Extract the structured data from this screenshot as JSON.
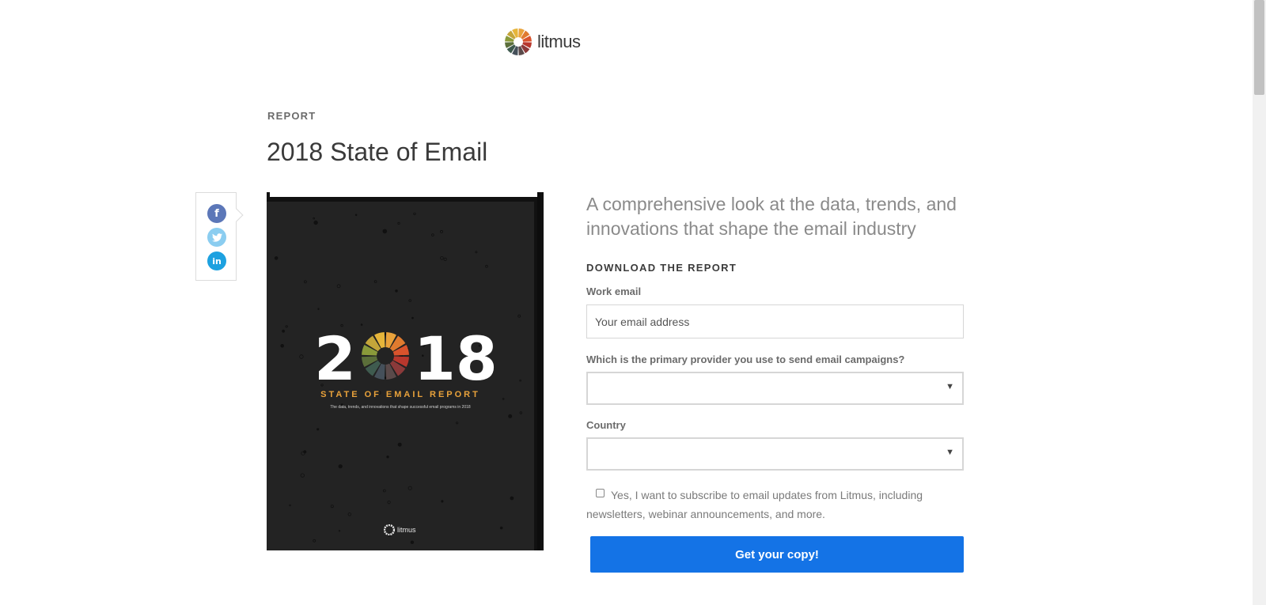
{
  "header": {
    "logo_text": "litmus"
  },
  "eyebrow": "REPORT",
  "title": "2018 State of Email",
  "share": {
    "icons": [
      "facebook-icon",
      "twitter-icon",
      "linkedin-icon"
    ],
    "colors": {
      "facebook": "#5c77b8",
      "twitter": "#8bcdf0",
      "linkedin": "#1da1e0"
    }
  },
  "cover": {
    "year": "2018",
    "subtitle": "STATE OF EMAIL REPORT",
    "tagline": "The data, trends, and innovations that shape successful email programs in 2018",
    "logo_text": "litmus"
  },
  "lede": "A comprehensive look at the data, trends, and innovations that shape the email industry",
  "form": {
    "heading": "DOWNLOAD THE REPORT",
    "email_label": "Work email",
    "email_placeholder": "Your email address",
    "provider_label": "Which is the primary provider you use to send email campaigns?",
    "provider_value": "",
    "country_label": "Country",
    "country_value": "",
    "consent_text": "Yes, I want to subscribe to email updates from Litmus, including newsletters, webinar announcements, and more.",
    "submit_label": "Get your copy!"
  },
  "colors": {
    "accent": "#1473e6",
    "cover_bg": "#232323",
    "cover_subtitle": "#e9a23b"
  }
}
